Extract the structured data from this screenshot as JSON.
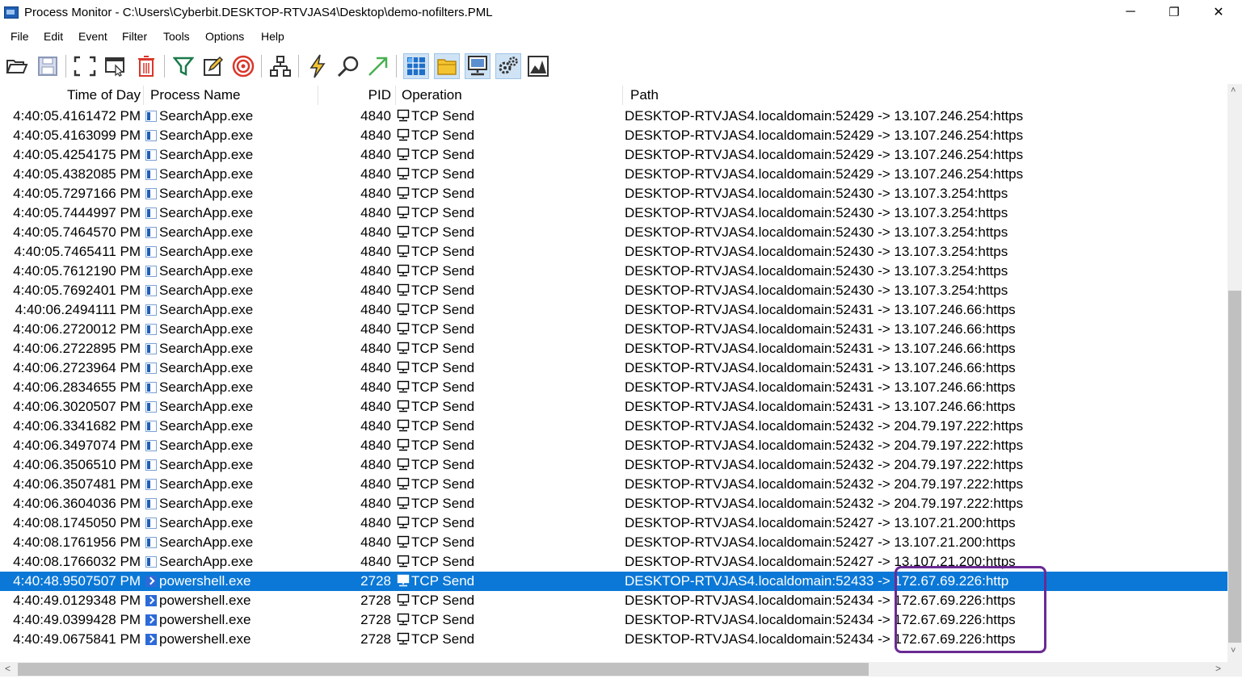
{
  "window": {
    "title": "Process Monitor - C:\\Users\\Cyberbit.DESKTOP-RTVJAS4\\Desktop\\demo-nofilters.PML",
    "minimize": "─",
    "restore": "❐",
    "close": "✕"
  },
  "menu": [
    "File",
    "Edit",
    "Event",
    "Filter",
    "Tools",
    "Options",
    "Help"
  ],
  "toolbar": [
    {
      "name": "open-icon"
    },
    {
      "name": "save-icon"
    },
    {
      "name": "autoscroll-icon"
    },
    {
      "name": "capture-icon"
    },
    {
      "name": "clear-icon"
    },
    {
      "name": "filter-icon"
    },
    {
      "name": "highlight-icon"
    },
    {
      "name": "target-icon"
    },
    {
      "name": "process-tree-icon"
    },
    {
      "name": "event-properties-icon"
    },
    {
      "name": "find-icon"
    },
    {
      "name": "jump-to-icon"
    },
    {
      "name": "registry-activity-icon"
    },
    {
      "name": "file-activity-icon"
    },
    {
      "name": "network-activity-icon"
    },
    {
      "name": "process-activity-icon"
    },
    {
      "name": "profiling-icon"
    }
  ],
  "columns": {
    "time": "Time of Day",
    "process": "Process Name",
    "pid": "PID",
    "operation": "Operation",
    "path": "Path"
  },
  "rows": [
    {
      "time": "4:40:05.4161472 PM",
      "process": "SearchApp.exe",
      "icon": "searchapp",
      "pid": "4840",
      "operation": "TCP Send",
      "path": "DESKTOP-RTVJAS4.localdomain:52429 -> 13.107.246.254:https"
    },
    {
      "time": "4:40:05.4163099 PM",
      "process": "SearchApp.exe",
      "icon": "searchapp",
      "pid": "4840",
      "operation": "TCP Send",
      "path": "DESKTOP-RTVJAS4.localdomain:52429 -> 13.107.246.254:https"
    },
    {
      "time": "4:40:05.4254175 PM",
      "process": "SearchApp.exe",
      "icon": "searchapp",
      "pid": "4840",
      "operation": "TCP Send",
      "path": "DESKTOP-RTVJAS4.localdomain:52429 -> 13.107.246.254:https"
    },
    {
      "time": "4:40:05.4382085 PM",
      "process": "SearchApp.exe",
      "icon": "searchapp",
      "pid": "4840",
      "operation": "TCP Send",
      "path": "DESKTOP-RTVJAS4.localdomain:52429 -> 13.107.246.254:https"
    },
    {
      "time": "4:40:05.7297166 PM",
      "process": "SearchApp.exe",
      "icon": "searchapp",
      "pid": "4840",
      "operation": "TCP Send",
      "path": "DESKTOP-RTVJAS4.localdomain:52430 -> 13.107.3.254:https"
    },
    {
      "time": "4:40:05.7444997 PM",
      "process": "SearchApp.exe",
      "icon": "searchapp",
      "pid": "4840",
      "operation": "TCP Send",
      "path": "DESKTOP-RTVJAS4.localdomain:52430 -> 13.107.3.254:https"
    },
    {
      "time": "4:40:05.7464570 PM",
      "process": "SearchApp.exe",
      "icon": "searchapp",
      "pid": "4840",
      "operation": "TCP Send",
      "path": "DESKTOP-RTVJAS4.localdomain:52430 -> 13.107.3.254:https"
    },
    {
      "time": "4:40:05.7465411 PM",
      "process": "SearchApp.exe",
      "icon": "searchapp",
      "pid": "4840",
      "operation": "TCP Send",
      "path": "DESKTOP-RTVJAS4.localdomain:52430 -> 13.107.3.254:https"
    },
    {
      "time": "4:40:05.7612190 PM",
      "process": "SearchApp.exe",
      "icon": "searchapp",
      "pid": "4840",
      "operation": "TCP Send",
      "path": "DESKTOP-RTVJAS4.localdomain:52430 -> 13.107.3.254:https"
    },
    {
      "time": "4:40:05.7692401 PM",
      "process": "SearchApp.exe",
      "icon": "searchapp",
      "pid": "4840",
      "operation": "TCP Send",
      "path": "DESKTOP-RTVJAS4.localdomain:52430 -> 13.107.3.254:https"
    },
    {
      "time": "4:40:06.2494111 PM",
      "process": "SearchApp.exe",
      "icon": "searchapp",
      "pid": "4840",
      "operation": "TCP Send",
      "path": "DESKTOP-RTVJAS4.localdomain:52431 -> 13.107.246.66:https"
    },
    {
      "time": "4:40:06.2720012 PM",
      "process": "SearchApp.exe",
      "icon": "searchapp",
      "pid": "4840",
      "operation": "TCP Send",
      "path": "DESKTOP-RTVJAS4.localdomain:52431 -> 13.107.246.66:https"
    },
    {
      "time": "4:40:06.2722895 PM",
      "process": "SearchApp.exe",
      "icon": "searchapp",
      "pid": "4840",
      "operation": "TCP Send",
      "path": "DESKTOP-RTVJAS4.localdomain:52431 -> 13.107.246.66:https"
    },
    {
      "time": "4:40:06.2723964 PM",
      "process": "SearchApp.exe",
      "icon": "searchapp",
      "pid": "4840",
      "operation": "TCP Send",
      "path": "DESKTOP-RTVJAS4.localdomain:52431 -> 13.107.246.66:https"
    },
    {
      "time": "4:40:06.2834655 PM",
      "process": "SearchApp.exe",
      "icon": "searchapp",
      "pid": "4840",
      "operation": "TCP Send",
      "path": "DESKTOP-RTVJAS4.localdomain:52431 -> 13.107.246.66:https"
    },
    {
      "time": "4:40:06.3020507 PM",
      "process": "SearchApp.exe",
      "icon": "searchapp",
      "pid": "4840",
      "operation": "TCP Send",
      "path": "DESKTOP-RTVJAS4.localdomain:52431 -> 13.107.246.66:https"
    },
    {
      "time": "4:40:06.3341682 PM",
      "process": "SearchApp.exe",
      "icon": "searchapp",
      "pid": "4840",
      "operation": "TCP Send",
      "path": "DESKTOP-RTVJAS4.localdomain:52432 -> 204.79.197.222:https"
    },
    {
      "time": "4:40:06.3497074 PM",
      "process": "SearchApp.exe",
      "icon": "searchapp",
      "pid": "4840",
      "operation": "TCP Send",
      "path": "DESKTOP-RTVJAS4.localdomain:52432 -> 204.79.197.222:https"
    },
    {
      "time": "4:40:06.3506510 PM",
      "process": "SearchApp.exe",
      "icon": "searchapp",
      "pid": "4840",
      "operation": "TCP Send",
      "path": "DESKTOP-RTVJAS4.localdomain:52432 -> 204.79.197.222:https"
    },
    {
      "time": "4:40:06.3507481 PM",
      "process": "SearchApp.exe",
      "icon": "searchapp",
      "pid": "4840",
      "operation": "TCP Send",
      "path": "DESKTOP-RTVJAS4.localdomain:52432 -> 204.79.197.222:https"
    },
    {
      "time": "4:40:06.3604036 PM",
      "process": "SearchApp.exe",
      "icon": "searchapp",
      "pid": "4840",
      "operation": "TCP Send",
      "path": "DESKTOP-RTVJAS4.localdomain:52432 -> 204.79.197.222:https"
    },
    {
      "time": "4:40:08.1745050 PM",
      "process": "SearchApp.exe",
      "icon": "searchapp",
      "pid": "4840",
      "operation": "TCP Send",
      "path": "DESKTOP-RTVJAS4.localdomain:52427 -> 13.107.21.200:https"
    },
    {
      "time": "4:40:08.1761956 PM",
      "process": "SearchApp.exe",
      "icon": "searchapp",
      "pid": "4840",
      "operation": "TCP Send",
      "path": "DESKTOP-RTVJAS4.localdomain:52427 -> 13.107.21.200:https"
    },
    {
      "time": "4:40:08.1766032 PM",
      "process": "SearchApp.exe",
      "icon": "searchapp",
      "pid": "4840",
      "operation": "TCP Send",
      "path": "DESKTOP-RTVJAS4.localdomain:52427 -> 13.107.21.200:https"
    },
    {
      "time": "4:40:48.9507507 PM",
      "process": "powershell.exe",
      "icon": "powershell",
      "pid": "2728",
      "operation": "TCP Send",
      "path": "DESKTOP-RTVJAS4.localdomain:52433 -> 172.67.69.226:http",
      "selected": true
    },
    {
      "time": "4:40:49.0129348 PM",
      "process": "powershell.exe",
      "icon": "powershell",
      "pid": "2728",
      "operation": "TCP Send",
      "path": "DESKTOP-RTVJAS4.localdomain:52434 -> 172.67.69.226:https"
    },
    {
      "time": "4:40:49.0399428 PM",
      "process": "powershell.exe",
      "icon": "powershell",
      "pid": "2728",
      "operation": "TCP Send",
      "path": "DESKTOP-RTVJAS4.localdomain:52434 -> 172.67.69.226:https"
    },
    {
      "time": "4:40:49.0675841 PM",
      "process": "powershell.exe",
      "icon": "powershell",
      "pid": "2728",
      "operation": "TCP Send",
      "path": "DESKTOP-RTVJAS4.localdomain:52434 -> 172.67.69.226:https"
    }
  ],
  "colors": {
    "selection": "#0b78d7",
    "annotation": "#6a2a94"
  },
  "scroll": {
    "up": "˄",
    "down": "˅",
    "left": "<",
    "right": ">"
  }
}
